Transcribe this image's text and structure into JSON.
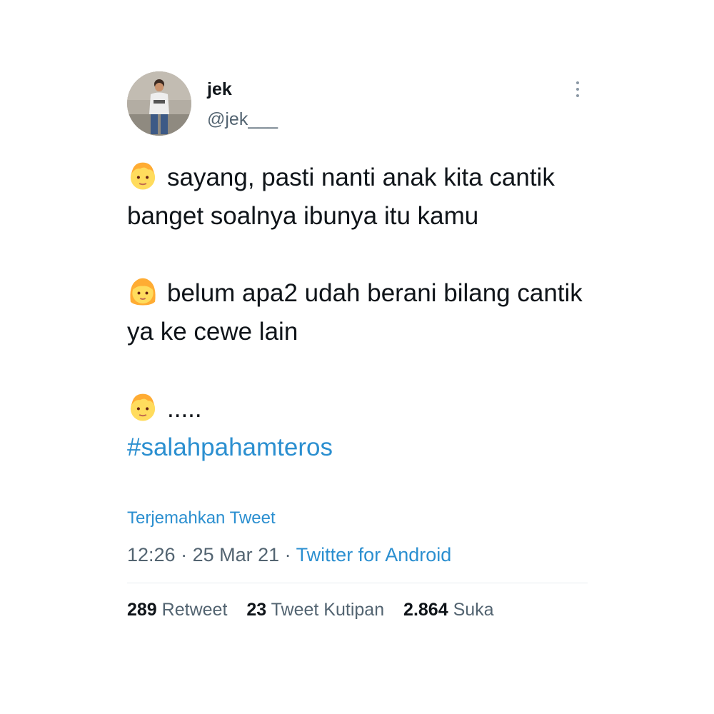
{
  "user": {
    "display_name": "jek",
    "handle": "@jek___"
  },
  "tweet": {
    "line1": "sayang, pasti nanti anak kita cantik banget soalnya ibunya itu kamu",
    "line2": "belum apa2 udah berani bilang cantik ya ke cewe lain",
    "line3": ".....",
    "hashtag": "#salahpahamteros",
    "emoji_1": "boy-face-emoji-icon",
    "emoji_2": "girl-face-emoji-icon",
    "emoji_3": "boy-face-emoji-icon"
  },
  "translate_label": "Terjemahkan Tweet",
  "meta": {
    "time": "12:26",
    "separator": " · ",
    "date": "25 Mar 21",
    "source": "Twitter for Android"
  },
  "stats": {
    "retweets_count": "289",
    "retweets_label": "Retweet",
    "quotes_count": "23",
    "quotes_label": "Tweet Kutipan",
    "likes_count": "2.864",
    "likes_label": "Suka"
  },
  "colors": {
    "link": "#2b8fd0",
    "text": "#0f1419",
    "secondary": "#536471"
  }
}
